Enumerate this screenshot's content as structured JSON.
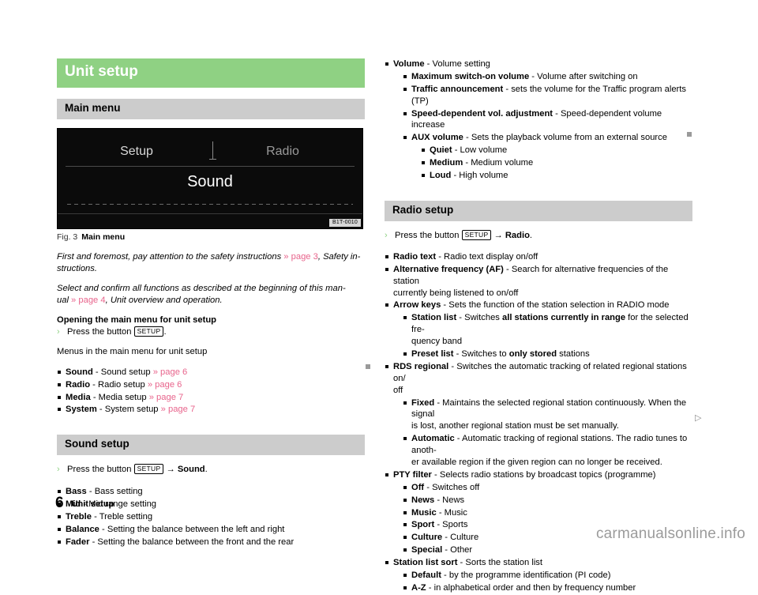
{
  "page": {
    "number": "6",
    "footer_title": "Unit setup",
    "watermark": "carmanualsonline.info"
  },
  "left": {
    "h1": "Unit setup",
    "h2_main_menu": "Main menu",
    "figure": {
      "setup_label": "Setup",
      "radio_label": "Radio",
      "sound_label": "Sound",
      "code": "B1T-0010",
      "caption_num": "Fig. 3",
      "caption_title": "Main menu"
    },
    "para1_a": "First and foremost, pay attention to the safety instructions ",
    "para1_ref": "» page 3",
    "para1_b": ", Safety in-",
    "para1_c": "structions.",
    "para2_a": "Select and confirm all functions as described at the beginning of this man-",
    "para2_b": "ual ",
    "para2_ref": "» page 4",
    "para2_c": ", Unit overview and operation.",
    "subhead_opening": "Opening the main menu for unit setup",
    "step_press_a": "Press the button ",
    "step_press_key": "SETUP",
    "step_press_b": ".",
    "menus_line": "Menus in the main menu for unit setup",
    "menu_items": [
      {
        "term": "Sound",
        "desc": " - Sound setup ",
        "ref": "» page 6"
      },
      {
        "term": "Radio",
        "desc": " - Radio setup ",
        "ref": "» page 6"
      },
      {
        "term": "Media",
        "desc": " - Media setup ",
        "ref": "» page 7"
      },
      {
        "term": "System",
        "desc": " - System setup ",
        "ref": "» page 7"
      }
    ],
    "h2_sound_setup": "Sound setup",
    "sound_step_a": "Press the button ",
    "sound_step_key": "SETUP",
    "sound_step_b": " → ",
    "sound_step_c": "Sound",
    "sound_step_d": ".",
    "sound_items": [
      {
        "term": "Bass",
        "desc": " - Bass setting"
      },
      {
        "term": "Mid",
        "desc": " - Mid range setting"
      },
      {
        "term": "Treble",
        "desc": " - Treble setting"
      },
      {
        "term": "Balance",
        "desc": " - Setting the balance between the left and right"
      },
      {
        "term": "Fader",
        "desc": " - Setting the balance between the front and the rear"
      }
    ]
  },
  "right": {
    "volume": {
      "term": "Volume",
      "desc": " - Volume setting",
      "sub": [
        {
          "term": "Maximum switch-on volume",
          "desc": " - Volume after switching on"
        },
        {
          "term": "Traffic announcement",
          "desc": " - sets the volume for the Traffic program alerts (TP)"
        },
        {
          "term": "Speed-dependent vol. adjustment",
          "desc": " - Speed-dependent volume increase"
        },
        {
          "term": "AUX volume",
          "desc": " - Sets the playback volume from an external source"
        }
      ],
      "sub3": [
        {
          "term": "Quiet",
          "desc": " - Low volume"
        },
        {
          "term": "Medium",
          "desc": " - Medium volume"
        },
        {
          "term": "Loud",
          "desc": " - High volume"
        }
      ]
    },
    "h2_radio_setup": "Radio setup",
    "radio_step_a": "Press the button ",
    "radio_step_key": "SETUP",
    "radio_step_b": " → ",
    "radio_step_c": "Radio",
    "radio_step_d": ".",
    "radio_text": {
      "term": "Radio text",
      "desc": " - Radio text display on/off"
    },
    "alt_freq": {
      "term": "Alternative frequency (AF)",
      "desc": " - Search for alternative frequencies of the station",
      "desc2": "currently being listened to on/off"
    },
    "arrow_keys": {
      "term": "Arrow keys",
      "desc": " - Sets the function of the station selection in RADIO mode",
      "sub": [
        {
          "term": "Station list",
          "desc": " - Switches ",
          "bold2": "all stations currently in range",
          "desc2": " for the selected fre-",
          "desc3": "quency band"
        },
        {
          "term": "Preset list",
          "desc": " - Switches to ",
          "bold2": "only stored",
          "desc2": " stations"
        }
      ]
    },
    "rds_regional": {
      "term": "RDS regional",
      "desc": " - Switches the automatic tracking of related regional stations on/",
      "desc2": "off",
      "sub": [
        {
          "term": "Fixed",
          "desc": " - Maintains the selected regional station continuously. When the signal",
          "desc2": "is lost, another regional station must be set manually."
        },
        {
          "term": "Automatic",
          "desc": " - Automatic tracking of regional stations. The radio tunes to anoth-",
          "desc2": "er available region if the given region can no longer be received."
        }
      ]
    },
    "pty_filter": {
      "term": "PTY filter",
      "desc": " - Selects radio stations by broadcast topics (programme)",
      "sub": [
        {
          "term": "Off",
          "desc": " - Switches off"
        },
        {
          "term": "News",
          "desc": " - News"
        },
        {
          "term": "Music",
          "desc": " - Music"
        },
        {
          "term": "Sport",
          "desc": " - Sports"
        },
        {
          "term": "Culture",
          "desc": " - Culture"
        },
        {
          "term": "Special",
          "desc": " - Other"
        }
      ]
    },
    "station_list_sort": {
      "term": "Station list sort",
      "desc": " - Sorts the station list",
      "sub": [
        {
          "term": "Default",
          "desc": " - by the programme identification (PI code)"
        },
        {
          "term": "A-Z",
          "desc": " - in alphabetical order and then by frequency number"
        }
      ]
    }
  },
  "marks": {
    "left_mark": "▤",
    "right_mark": "▤",
    "triangle": "▷"
  }
}
